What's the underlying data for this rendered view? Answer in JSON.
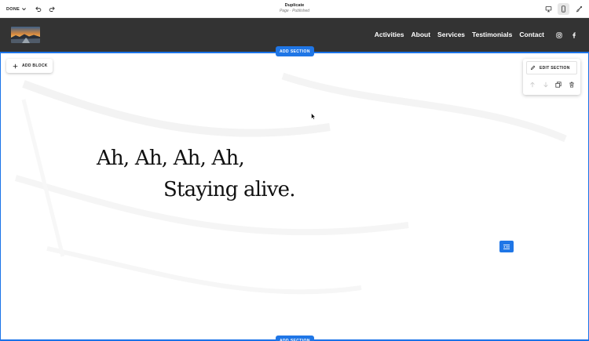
{
  "editor_bar": {
    "done_label": "DONE",
    "page_name": "Duplicate",
    "page_status": "Page · Published"
  },
  "site": {
    "nav": [
      "Activities",
      "About",
      "Services",
      "Testimonials",
      "Contact"
    ]
  },
  "editor": {
    "add_section_label": "ADD SECTION",
    "add_block_label": "ADD BLOCK",
    "edit_section_label": "EDIT SECTION"
  },
  "content": {
    "line1": "Ah, Ah, Ah, Ah,",
    "line2": "Staying alive."
  },
  "colors": {
    "accent": "#1f76e6",
    "header_bg": "#333333",
    "text": "#111111",
    "page_bg": "#ffffff"
  },
  "icons": {
    "undo": "undo-icon",
    "redo": "redo-icon",
    "desktop": "desktop-icon",
    "mobile": "mobile-icon",
    "style": "brush-icon",
    "instagram": "instagram-icon",
    "facebook": "facebook-icon",
    "plus": "plus-icon",
    "pencil": "pencil-icon",
    "arrow_up": "arrow-up-icon",
    "arrow_down": "arrow-down-icon",
    "duplicate": "duplicate-icon",
    "trash": "trash-icon",
    "block_settings": "block-settings-icon"
  }
}
